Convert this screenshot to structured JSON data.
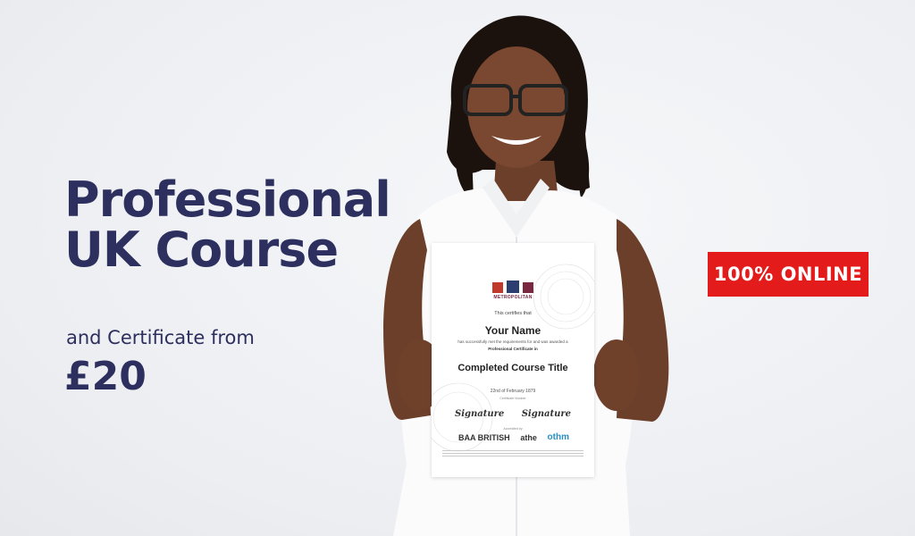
{
  "headline": {
    "line1": "Professional",
    "line2": "UK Course"
  },
  "subtitle": "and Certificate from",
  "price": "£20",
  "badge": "100% ONLINE",
  "certificate": {
    "logo_text": "METROPOLITAN",
    "certifies": "This certifies that",
    "name": "Your Name",
    "met_requirements": "has successfully met the requirements for and was awarded a",
    "award": "Professional Certificate in",
    "course_title": "Completed Course Title",
    "date": "22nd of February 1879",
    "certificate_number": "Certificate Number",
    "signature_1": "Signature",
    "signature_2": "Signature",
    "accredited_by": "Accredited by",
    "logo_baa": "BAA BRITISH",
    "logo_athe": "athe",
    "logo_othm": "othm"
  },
  "colors": {
    "headline": "#2d2f5e",
    "badge_bg": "#e41b1b",
    "badge_text": "#ffffff",
    "background": "#eef0f3"
  }
}
